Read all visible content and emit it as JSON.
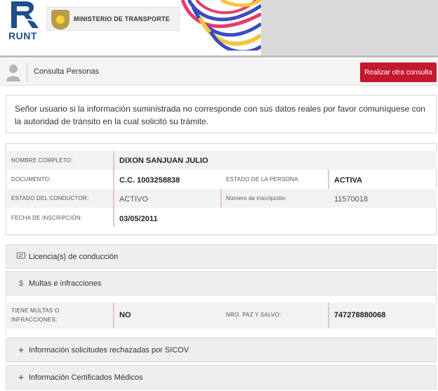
{
  "header": {
    "logo_text": "RUNT",
    "ministry": "MINISTERIO DE TRANSPORTE"
  },
  "titlebar": {
    "title": "Consulta Personas",
    "button": "Realizar otra consulta"
  },
  "notice": "Señor usuario si la información suministrada no corresponde con sus datos reales por favor comuníquese con la autoridad de tránsito en la cual solicitó su trámite.",
  "person": {
    "full_name_label": "NOMBRE COMPLETO:",
    "full_name": "DIXON SANJUAN JULIO",
    "document_label": "DOCUMENTO:",
    "document": "C.C. 1003258838",
    "person_status_label": "ESTADO DE LA PERSONA:",
    "person_status": "ACTIVA",
    "driver_status_label": "ESTADO DEL CONDUCTOR:",
    "driver_status": "ACTIVO",
    "registration_no_label": "Número de inscripción:",
    "registration_no": "11570018",
    "registration_date_label": "FECHA DE INSCRIPCIÓN:",
    "registration_date": "03/05/2011"
  },
  "sections": {
    "licenses": "Licencia(s) de conducción",
    "fines": "Multas e infracciones",
    "sicov": "Información solicitudes rechazadas por SICOV",
    "medical": "Información Certificados Médicos"
  },
  "fines": {
    "has_fines_label_1": "TIENE MULTAS O",
    "has_fines_label_2": "INFRACCIONES:",
    "has_fines": "NO",
    "paz_salvo_label": "NRO. PAZ Y SALVO:",
    "paz_salvo": "747278880068"
  },
  "icons": {
    "licenses": "id-card-icon",
    "fines": "dollar-icon",
    "sicov": "plus-icon",
    "medical": "plus-icon"
  },
  "colors": {
    "accent": "#c5192d",
    "brand_blue": "#1f4e8c"
  }
}
